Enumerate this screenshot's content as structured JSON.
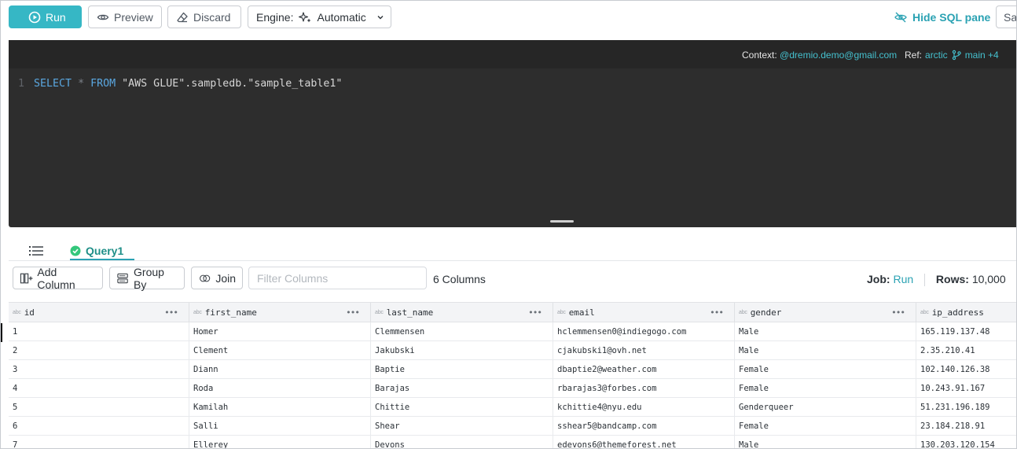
{
  "toolbar": {
    "run_label": "Run",
    "preview_label": "Preview",
    "discard_label": "Discard",
    "engine_label": "Engine:",
    "engine_value": "Automatic",
    "hide_sql_label": "Hide SQL pane",
    "cut_off_button_label": "Sa"
  },
  "editor": {
    "context_label": "Context:",
    "context_value": "@dremio.demo@gmail.com",
    "ref_label": "Ref:",
    "ref_value": "arctic",
    "branch_value": "main +4",
    "line_number": "1",
    "sql": {
      "select": "SELECT",
      "star": "*",
      "from": "FROM",
      "rest": "\"AWS GLUE\".sampledb.\"sample_table1\""
    }
  },
  "results": {
    "tab_label": "Query1",
    "add_column_label": "Add Column",
    "group_by_label": "Group By",
    "join_label": "Join",
    "filter_placeholder": "Filter Columns",
    "columns_count": "6 Columns",
    "job_label": "Job:",
    "job_value": "Run",
    "rows_label": "Rows:",
    "rows_value": "10,000",
    "cut_off_text": "1"
  },
  "grid": {
    "type_tag": "abc",
    "columns": [
      "id",
      "first_name",
      "last_name",
      "email",
      "gender",
      "ip_address"
    ],
    "rows": [
      [
        "1",
        "Homer",
        "Clemmensen",
        "hclemmensen0@indiegogo.com",
        "Male",
        "165.119.137.48"
      ],
      [
        "2",
        "Clement",
        "Jakubski",
        "cjakubski1@ovh.net",
        "Male",
        "2.35.210.41"
      ],
      [
        "3",
        "Diann",
        "Baptie",
        "dbaptie2@weather.com",
        "Female",
        "102.140.126.38"
      ],
      [
        "4",
        "Roda",
        "Barajas",
        "rbarajas3@forbes.com",
        "Female",
        "10.243.91.167"
      ],
      [
        "5",
        "Kamilah",
        "Chittie",
        "kchittie4@nyu.edu",
        "Genderqueer",
        "51.231.196.189"
      ],
      [
        "6",
        "Salli",
        "Shear",
        "sshear5@bandcamp.com",
        "Female",
        "23.184.218.91"
      ],
      [
        "7",
        "Ellerey",
        "Devons",
        "edevons6@themeforest.net",
        "Male",
        "130.203.120.154"
      ]
    ]
  },
  "colors": {
    "accent": "#36b7c5",
    "accent_text": "#2aa2b3",
    "editor_bg": "#2d2d2d",
    "success": "#34c77b"
  }
}
